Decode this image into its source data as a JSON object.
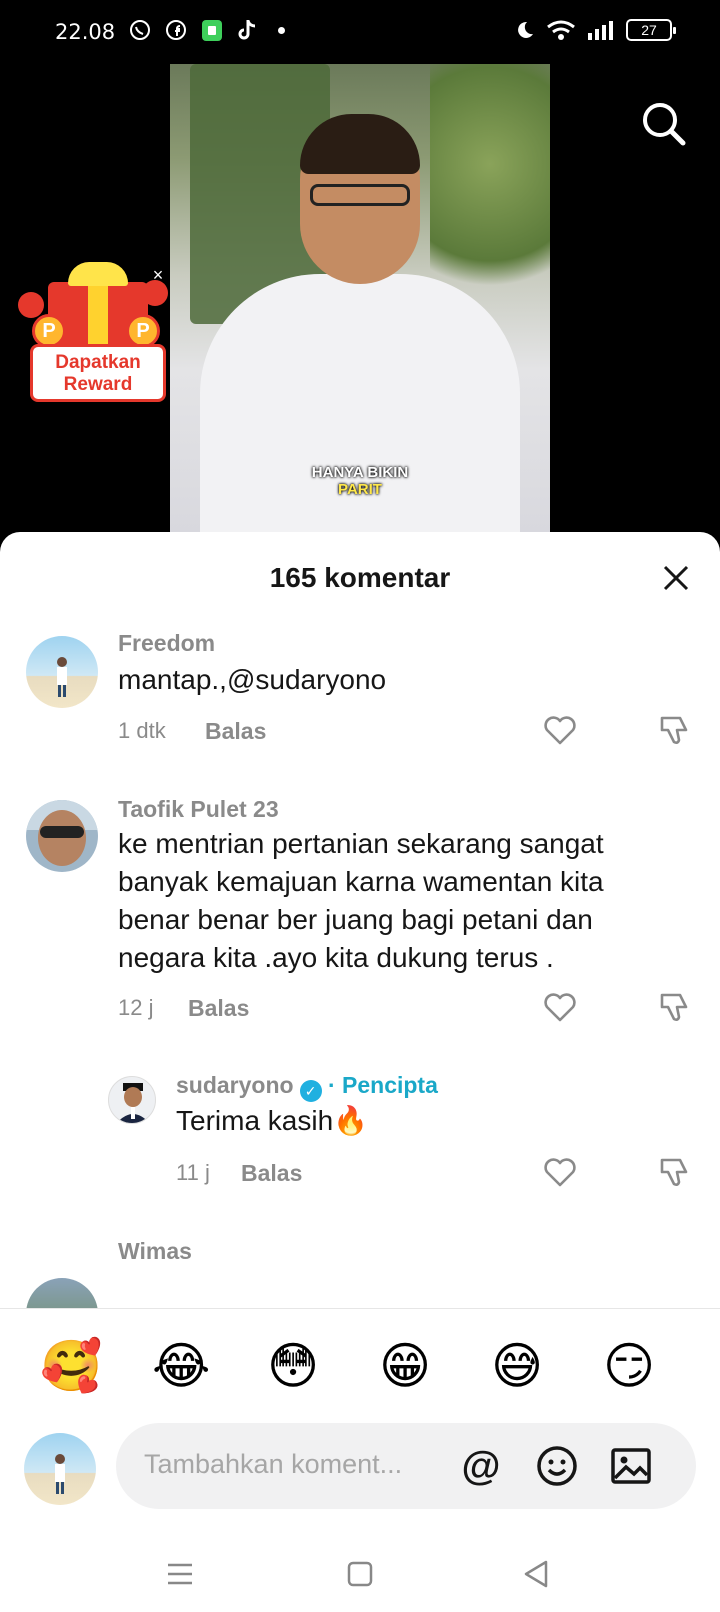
{
  "status_bar": {
    "time": "22.08",
    "icons_left": [
      "whatsapp-icon",
      "facebook-icon",
      "app-icon",
      "tiktok-icon"
    ],
    "icons_right": [
      "moon-icon",
      "wifi-icon",
      "signal-icon"
    ],
    "battery": "27"
  },
  "video": {
    "caption_line1": "HANYA BIKIN",
    "caption_line2": "PARIT"
  },
  "reward": {
    "label_line1": "Dapatkan",
    "label_line2": "Reward",
    "coin_letter": "P",
    "close_glyph": "×"
  },
  "sheet": {
    "title": "165 komentar"
  },
  "comments": [
    {
      "name": "Freedom",
      "text": "mantap.,@sudaryono",
      "time": "1 dtk",
      "reply": "Balas"
    },
    {
      "name": "Taofik Pulet 23",
      "text_lines": [
        "ke mentrian pertanian sekarang sangat",
        "banyak kemajuan karna wamentan kita",
        "benar benar ber juang bagi petani dan",
        "negara kita .ayo kita dukung terus ."
      ],
      "time": "12 j",
      "reply": "Balas"
    },
    {
      "name": "sudaryono",
      "badge": "· Pencipta",
      "text": "Terima kasih🔥",
      "time": "11 j",
      "reply": "Balas"
    },
    {
      "name": "Wimas"
    }
  ],
  "emojis": [
    "🥰",
    "😂",
    "😳",
    "😁",
    "😅",
    "😏"
  ],
  "input": {
    "placeholder": "Tambahkan koment...",
    "mention_glyph": "@"
  },
  "colors": {
    "accent_creator": "#1aa8c8",
    "reward_red": "#e5382c",
    "muted_text": "#8a8a8a"
  }
}
